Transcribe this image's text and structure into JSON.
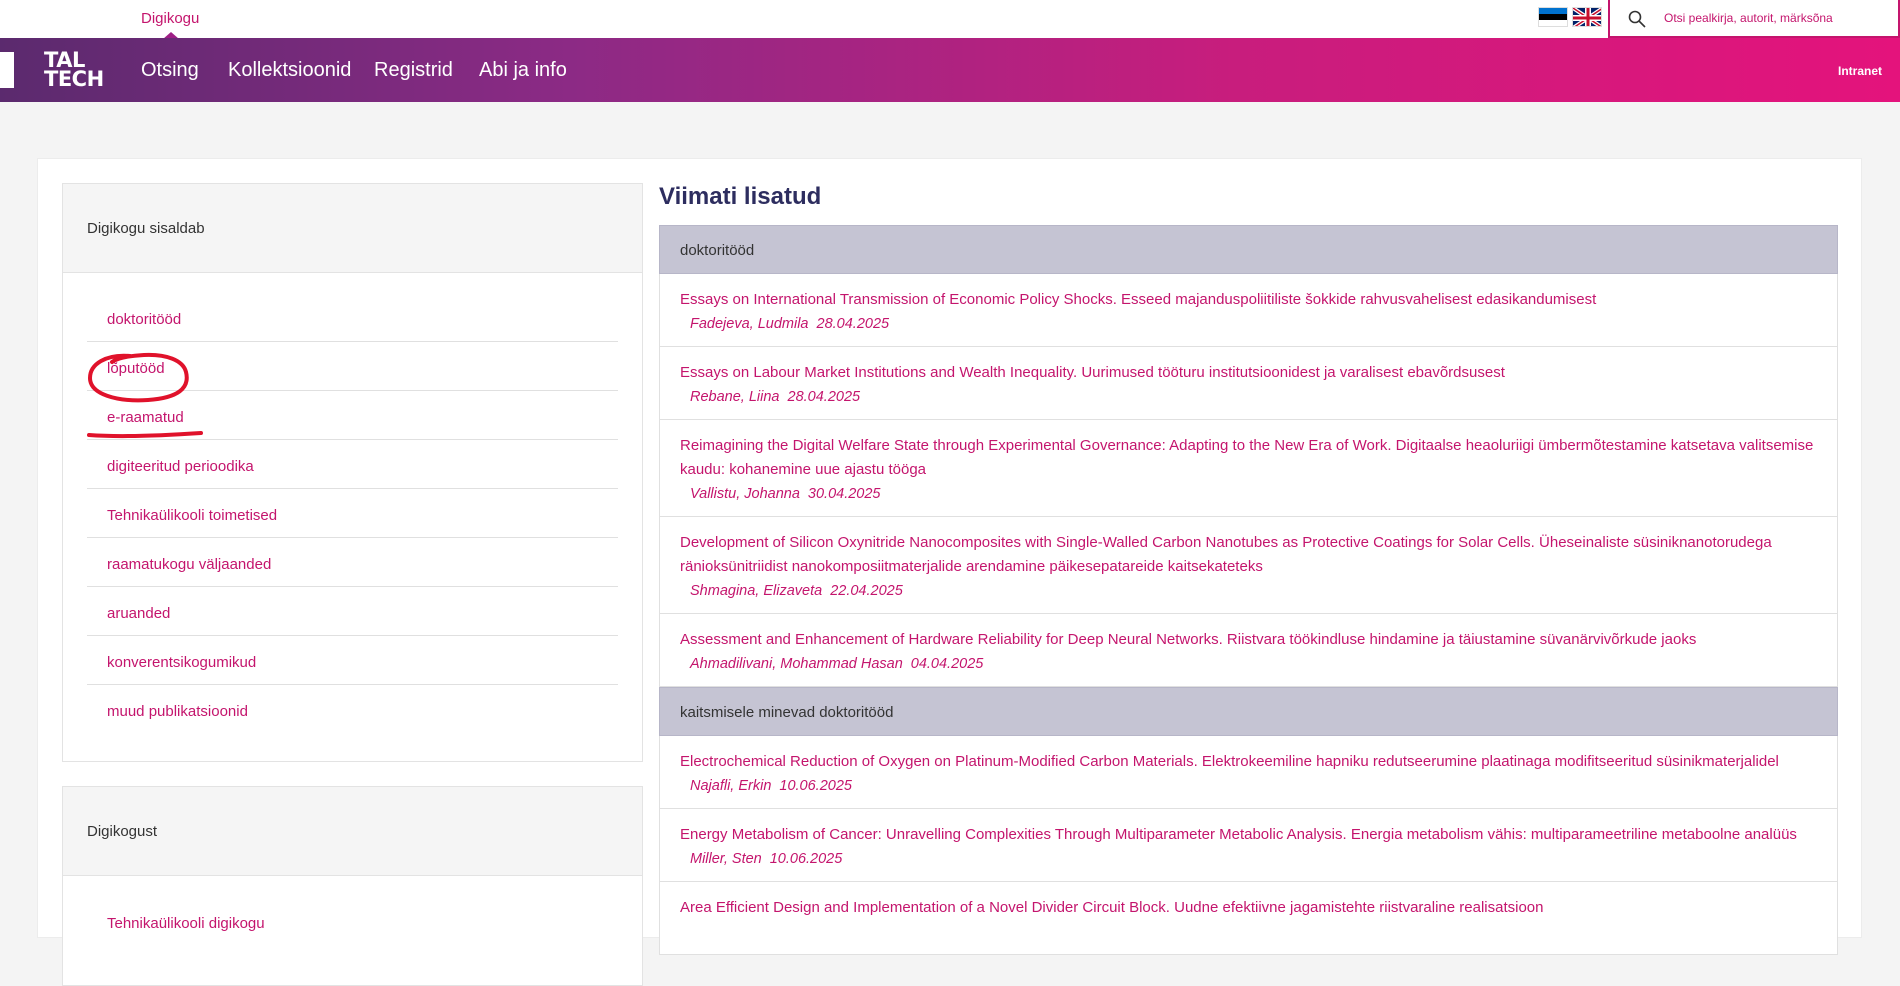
{
  "topbar": {
    "site_name": "Digikogu",
    "search_placeholder": "Otsi pealkirja, autorit, märksõna",
    "flags": [
      "estonian-flag",
      "english-flag"
    ]
  },
  "navbar": {
    "logo_line1": "TAL",
    "logo_line2": "TECH",
    "items": [
      "Otsing",
      "Kollektsioonid",
      "Registrid",
      "Abi ja info"
    ],
    "intranet": "Intranet"
  },
  "sidebar": {
    "panel1_title": "Digikogu sisaldab",
    "categories": [
      "doktoritööd",
      "lõputööd",
      "e-raamatud",
      "digiteeritud perioodika",
      "Tehnikaülikooli toimetised",
      "raamatukogu väljaanded",
      "aruanded",
      "konverentsikogumikud",
      "muud publikatsioonid"
    ],
    "panel2_title": "Digikogust",
    "panel2_link": "Tehnikaülikooli digikogu"
  },
  "main": {
    "title": "Viimati lisatud",
    "groups": [
      {
        "name": "doktoritööd",
        "items": [
          {
            "title": "Essays on International Transmission of Economic Policy Shocks. Esseed majanduspoliitiliste šokkide rahvusvahelisest edasikandumisest",
            "author": "Fadejeva, Ludmila",
            "date": "28.04.2025"
          },
          {
            "title": "Essays on Labour Market Institutions and Wealth Inequality. Uurimused tööturu institutsioonidest ja varalisest ebavõrdsusest",
            "author": "Rebane, Liina",
            "date": "28.04.2025"
          },
          {
            "title": "Reimagining the Digital Welfare State through Experimental Governance: Adapting to the New Era of Work. Digitaalse heaoluriigi ümbermõtestamine katsetava valitsemise kaudu: kohanemine uue ajastu tööga",
            "author": "Vallistu, Johanna",
            "date": "30.04.2025"
          },
          {
            "title": "Development of Silicon Oxynitride Nanocomposites with Single-Walled Carbon Nanotubes as Protective Coatings for Solar Cells. Üheseinaliste süsiniknanotorudega ränioksünitriidist nanokomposiitmaterjalide arendamine päikesepatareide kaitsekateteks",
            "author": "Shmagina, Elizaveta",
            "date": "22.04.2025"
          },
          {
            "title": "Assessment and Enhancement of Hardware Reliability for Deep Neural Networks. Riistvara töökindluse hindamine ja täiustamine süvanärvivõrkude jaoks",
            "author": "Ahmadilivani, Mohammad Hasan",
            "date": "04.04.2025"
          }
        ]
      },
      {
        "name": "kaitsmisele minevad doktoritööd",
        "items": [
          {
            "title": "Electrochemical Reduction of Oxygen on Platinum-Modified Carbon Materials. Elektrokeemiline hapniku redutseerumine plaatinaga modifitseeritud süsinikmaterjalidel",
            "author": "Najafli, Erkin",
            "date": "10.06.2025"
          },
          {
            "title": "Energy Metabolism of Cancer: Unravelling Complexities Through Multiparameter Metabolic Analysis. Energia metabolism vähis: multiparameetriline metaboolne analüüs",
            "author": "Miller, Sten",
            "date": "10.06.2025"
          },
          {
            "title": "Area Efficient Design and Implementation of a Novel Divider Circuit Block. Uudne efektiivne jagamistehte riistvaraline realisatsioon",
            "author": "",
            "date": ""
          }
        ]
      }
    ]
  },
  "colors": {
    "accent": "#c4156d",
    "title": "#2d2d5f",
    "group_header": "#c5c4d3",
    "annotation": "#e0122b"
  }
}
